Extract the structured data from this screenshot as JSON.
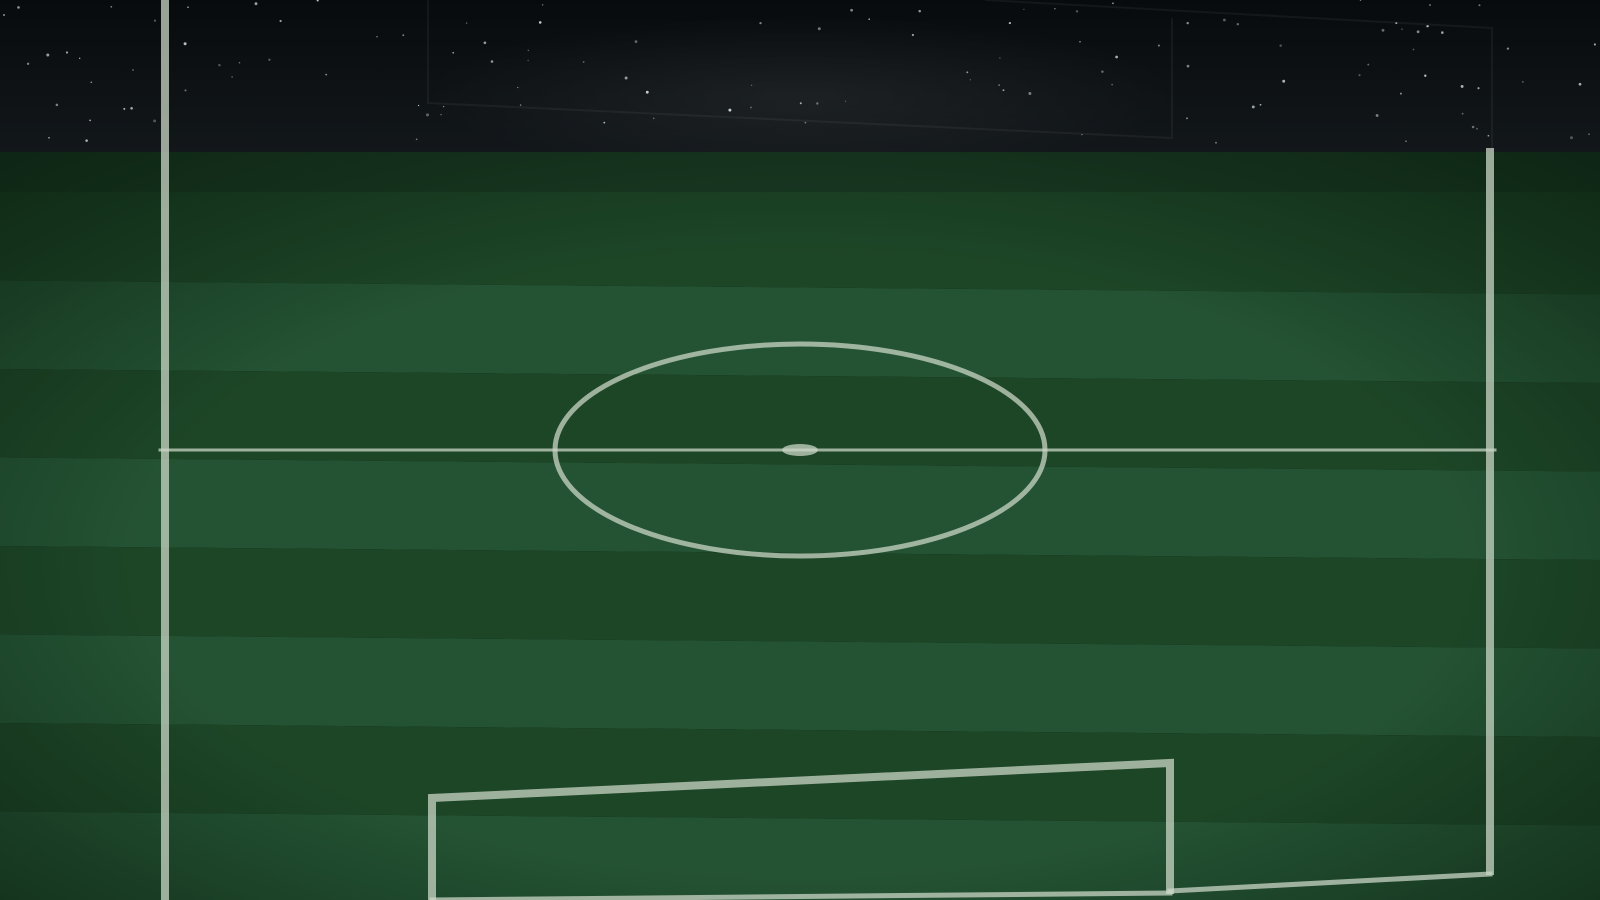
{
  "scene": {
    "colors": {
      "sky_top": "#080b0d",
      "sky_bottom": "#12171a",
      "grass_dark": "#1d4627",
      "grass_light": "#245333",
      "stand_band": "#193a23",
      "line": "#c9d6c6",
      "star": "#d9e2e6",
      "vignette": "#0a1e0f"
    },
    "icons": {
      "pitch": "soccer-pitch-icon",
      "stars": "night-sky-stars-icon"
    }
  }
}
